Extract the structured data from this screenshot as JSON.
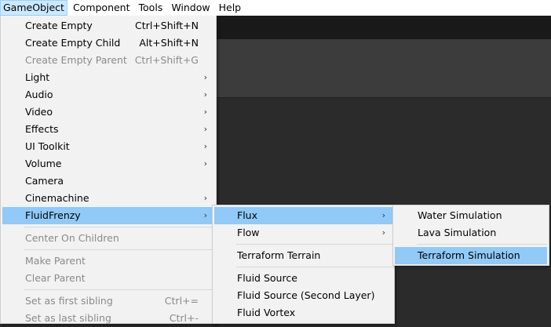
{
  "menubar": {
    "items": [
      "GameObject",
      "Component",
      "Tools",
      "Window",
      "Help"
    ]
  },
  "gameobject_menu": {
    "items": [
      {
        "label": "Create Empty",
        "shortcut": "Ctrl+Shift+N"
      },
      {
        "label": "Create Empty Child",
        "shortcut": "Alt+Shift+N"
      },
      {
        "label": "Create Empty Parent",
        "shortcut": "Ctrl+Shift+G"
      },
      {
        "label": "Light"
      },
      {
        "label": "Audio"
      },
      {
        "label": "Video"
      },
      {
        "label": "Effects"
      },
      {
        "label": "UI Toolkit"
      },
      {
        "label": "Volume"
      },
      {
        "label": "Camera"
      },
      {
        "label": "Cinemachine"
      },
      {
        "label": "FluidFrenzy"
      },
      {
        "label": "Center On Children"
      },
      {
        "label": "Make Parent"
      },
      {
        "label": "Clear Parent"
      },
      {
        "label": "Set as first sibling",
        "shortcut": "Ctrl+="
      },
      {
        "label": "Set as last sibling",
        "shortcut": "Ctrl+-"
      }
    ],
    "arrow_glyph": "›"
  },
  "fluidfrenzy_menu": {
    "items": [
      {
        "label": "Flux"
      },
      {
        "label": "Flow"
      },
      {
        "label": "Terraform Terrain"
      },
      {
        "label": "Fluid Source"
      },
      {
        "label": "Fluid Source (Second Layer)"
      },
      {
        "label": "Fluid Vortex"
      }
    ]
  },
  "flux_menu": {
    "items": [
      {
        "label": "Water Simulation"
      },
      {
        "label": "Lava Simulation"
      },
      {
        "label": "Terraform Simulation"
      }
    ]
  },
  "colors": {
    "highlight": "#91c9f7",
    "menubar_active": "#cce8ff",
    "menu_bg": "#f2f2f2",
    "disabled_text": "#8a8a8a"
  }
}
